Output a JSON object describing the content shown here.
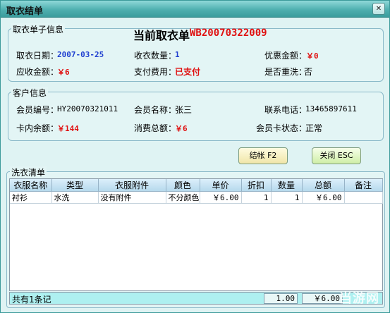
{
  "window": {
    "title": "取衣结单",
    "close_glyph": "✕"
  },
  "order_info": {
    "legend": "取衣单子信息",
    "heading_label": "当前取衣单",
    "order_no": "WB20070322009",
    "take_date_label": "取衣日期：",
    "take_date": "2007-03-25",
    "qty_label": "收衣数量：",
    "qty": "1",
    "discount_label": "优惠金额：",
    "discount": "￥0",
    "receivable_label": "应收金额：",
    "receivable": "￥6",
    "payment_label": "支付费用：",
    "payment": "已支付",
    "rewash_label": "是否重洗：",
    "rewash": "否"
  },
  "customer_info": {
    "legend": "客户信息",
    "member_no_label": "会员编号：",
    "member_no": "HY20070321011",
    "member_name_label": "会员名称：",
    "member_name": "张三",
    "phone_label": "联系电话：",
    "phone": "13465897611",
    "balance_label": "卡内余额：",
    "balance": "￥144",
    "total_spent_label": "消费总额：",
    "total_spent": "￥6",
    "card_status_label": "会员卡状态：",
    "card_status": "正常"
  },
  "buttons": {
    "checkout_label": "结帐 F2",
    "close_label": "关闭 ESC"
  },
  "wash_list": {
    "legend": "洗衣清单",
    "columns": [
      "衣服名称",
      "类型",
      "衣服附件",
      "颜色",
      "单价",
      "折扣",
      "数量",
      "总额",
      "备注"
    ],
    "rows": [
      [
        "衬衫",
        "水洗",
        "没有附件",
        "不分颜色",
        "￥6.00",
        "1",
        "1",
        "￥6.00",
        ""
      ]
    ]
  },
  "footer": {
    "count_text": "共有1条记",
    "qty_total": "1.00",
    "amount_total": "￥6.00"
  },
  "watermark": "当游网"
}
